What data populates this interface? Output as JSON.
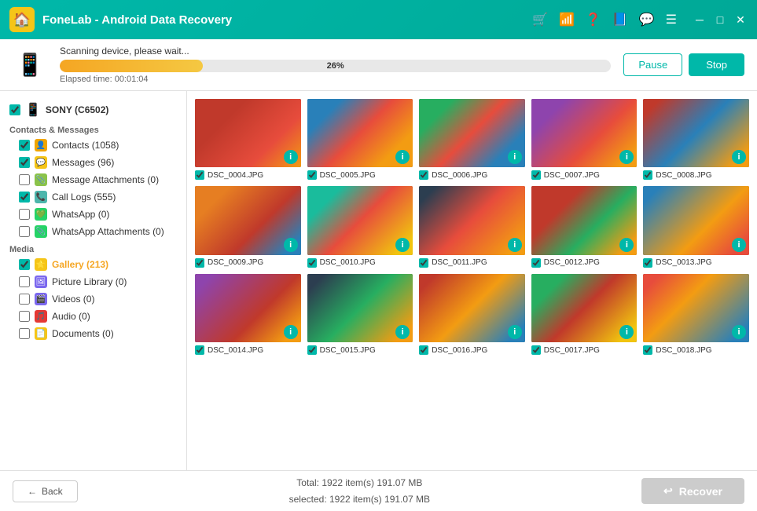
{
  "app": {
    "title": "FoneLab - Android Data Recovery"
  },
  "titlebar": {
    "icons": [
      "cart",
      "wifi",
      "question",
      "facebook",
      "chat",
      "menu",
      "minimize",
      "maximize",
      "close"
    ]
  },
  "scanbar": {
    "status": "Scanning device, please wait...",
    "progress_pct": "26%",
    "elapsed_label": "Elapsed time: 00:01:04",
    "pause_label": "Pause",
    "stop_label": "Stop"
  },
  "sidebar": {
    "device": {
      "name": "SONY (C6502)",
      "checked": true
    },
    "sections": [
      {
        "name": "Contacts & Messages",
        "items": [
          {
            "label": "Contacts (1058)",
            "icon": "contacts",
            "checked": true,
            "indeterminate": false
          },
          {
            "label": "Messages (96)",
            "icon": "messages",
            "checked": true,
            "indeterminate": false
          },
          {
            "label": "Message Attachments (0)",
            "icon": "msgatt",
            "checked": false,
            "indeterminate": true
          },
          {
            "label": "Call Logs (555)",
            "icon": "calllog",
            "checked": true,
            "indeterminate": false
          },
          {
            "label": "WhatsApp (0)",
            "icon": "whatsapp",
            "checked": false,
            "indeterminate": true
          },
          {
            "label": "WhatsApp Attachments (0)",
            "icon": "whatsappatt",
            "checked": false,
            "indeterminate": true
          }
        ]
      },
      {
        "name": "Media",
        "items": [
          {
            "label": "Gallery (213)",
            "icon": "gallery",
            "checked": true,
            "active": true,
            "indeterminate": false
          },
          {
            "label": "Picture Library (0)",
            "icon": "pictlib",
            "checked": false,
            "indeterminate": true
          },
          {
            "label": "Videos (0)",
            "icon": "videos",
            "checked": false,
            "indeterminate": true
          },
          {
            "label": "Audio (0)",
            "icon": "audio",
            "checked": false,
            "indeterminate": true
          },
          {
            "label": "Documents (0)",
            "icon": "docs",
            "checked": false,
            "indeterminate": true
          }
        ]
      }
    ]
  },
  "photos": [
    {
      "name": "DSC_0004.JPG",
      "style": "photo-1"
    },
    {
      "name": "DSC_0005.JPG",
      "style": "photo-2"
    },
    {
      "name": "DSC_0006.JPG",
      "style": "photo-3"
    },
    {
      "name": "DSC_0007.JPG",
      "style": "photo-4"
    },
    {
      "name": "DSC_0008.JPG",
      "style": "photo-5"
    },
    {
      "name": "DSC_0009.JPG",
      "style": "photo-6"
    },
    {
      "name": "DSC_0010.JPG",
      "style": "photo-7"
    },
    {
      "name": "DSC_0011.JPG",
      "style": "photo-8"
    },
    {
      "name": "DSC_0012.JPG",
      "style": "photo-9"
    },
    {
      "name": "DSC_0013.JPG",
      "style": "photo-10"
    },
    {
      "name": "DSC_0014.JPG",
      "style": "photo-11"
    },
    {
      "name": "DSC_0015.JPG",
      "style": "photo-12"
    },
    {
      "name": "DSC_0016.JPG",
      "style": "photo-13"
    },
    {
      "name": "DSC_0017.JPG",
      "style": "photo-14"
    },
    {
      "name": "DSC_0018.JPG",
      "style": "photo-15"
    }
  ],
  "footer": {
    "back_label": "Back",
    "total_line1": "Total: 1922 item(s) 191.07 MB",
    "total_line2": "selected: 1922 item(s) 191.07 MB",
    "recover_label": "Recover"
  }
}
